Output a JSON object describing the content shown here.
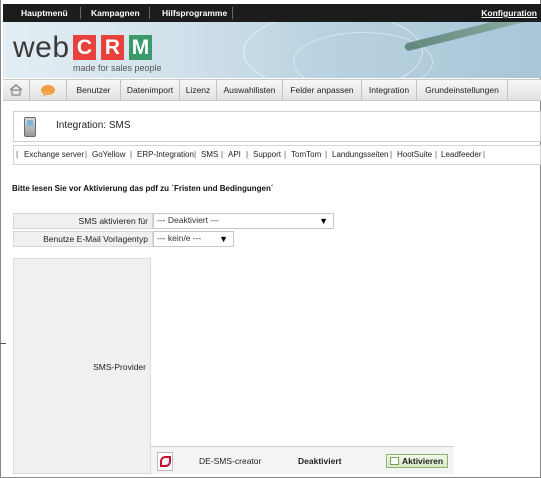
{
  "topbar": {
    "items": [
      "Hauptmenü",
      "Kampagnen",
      "Hilfsprogramme"
    ],
    "config_label": "Konfiguration"
  },
  "logo": {
    "prefix": "web",
    "letters": [
      "C",
      "R",
      "M"
    ],
    "letter_colors": [
      "#e8413c",
      "#e8413c",
      "#3a9a6b"
    ],
    "tagline": "made for sales people"
  },
  "nav": {
    "home_icon": "home-icon",
    "chat_icon": "chat-bubble-icon",
    "items": [
      "Benutzer",
      "Datenimport",
      "Lizenz",
      "Auswahllisten",
      "Felder anpassen",
      "Integration",
      "Grundeinstellungen"
    ]
  },
  "header": {
    "icon": "mobile-phone-icon",
    "title": "Integration: SMS"
  },
  "links": [
    "Exchange server",
    "GoYellow",
    "ERP-Integration",
    "SMS",
    "API",
    "Support",
    "TomTom",
    "Landungsseiten",
    "HootSuite",
    "Leadfeeder"
  ],
  "notice": "Bitte lesen Sie vor Aktivierung das pdf zu ´Fristen und Bedingungen´",
  "form": {
    "activate_label": "SMS aktivieren für",
    "activate_value": "--- Deaktiviert ---",
    "template_label": "Benutze E-Mail Vorlagentyp",
    "template_value": "--- kein/e ---",
    "provider_label": "SMS-Provider"
  },
  "provider": {
    "icon": "pdf-icon",
    "name": "DE-SMS-creator",
    "status": "Deaktiviert",
    "button_label": "Aktivieren"
  },
  "colors": {
    "topbar": "#1c1c1c",
    "button_green": "#d7e9c4"
  }
}
